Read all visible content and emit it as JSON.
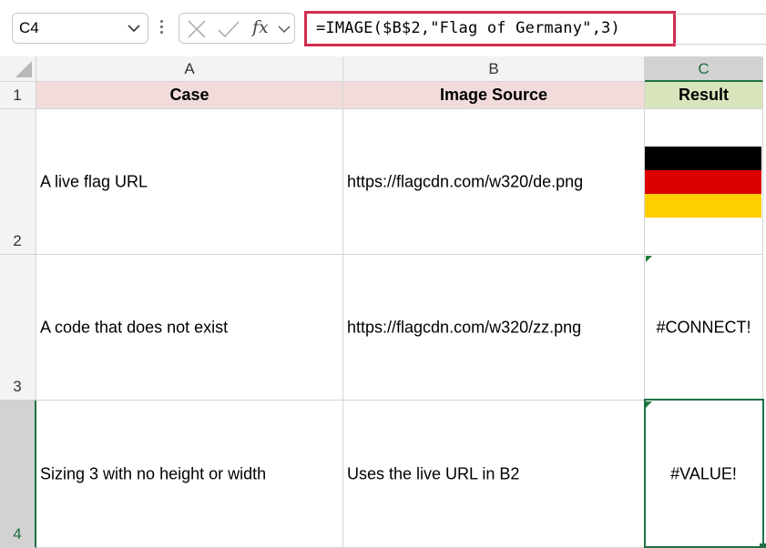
{
  "formula_bar": {
    "name_box": "C4",
    "fx_label": "fx",
    "formula": "=IMAGE($B$2,\"Flag of Germany\",3)"
  },
  "columns": [
    "A",
    "B",
    "C"
  ],
  "rows": [
    "1",
    "2",
    "3",
    "4"
  ],
  "table": {
    "headers": [
      "Case",
      "Image Source",
      "Result"
    ],
    "rows": [
      {
        "case": "A live flag URL",
        "source": "https://flagcdn.com/w320/de.png",
        "result": ""
      },
      {
        "case": "A code that does not exist",
        "source": "https://flagcdn.com/w320/zz.png",
        "result": "#CONNECT!"
      },
      {
        "case": "Sizing 3 with no height or width",
        "source": "Uses the live URL in B2",
        "result": "#VALUE!"
      }
    ]
  },
  "selection": {
    "active_cell": "C4"
  },
  "colors": {
    "header_pink": "#f2dcdb",
    "header_green": "#d8e4bc",
    "selection_green": "#1e7145",
    "formula_highlight": "#d12d4f",
    "flag": [
      "#000000",
      "#dd0000",
      "#ffce00"
    ]
  }
}
